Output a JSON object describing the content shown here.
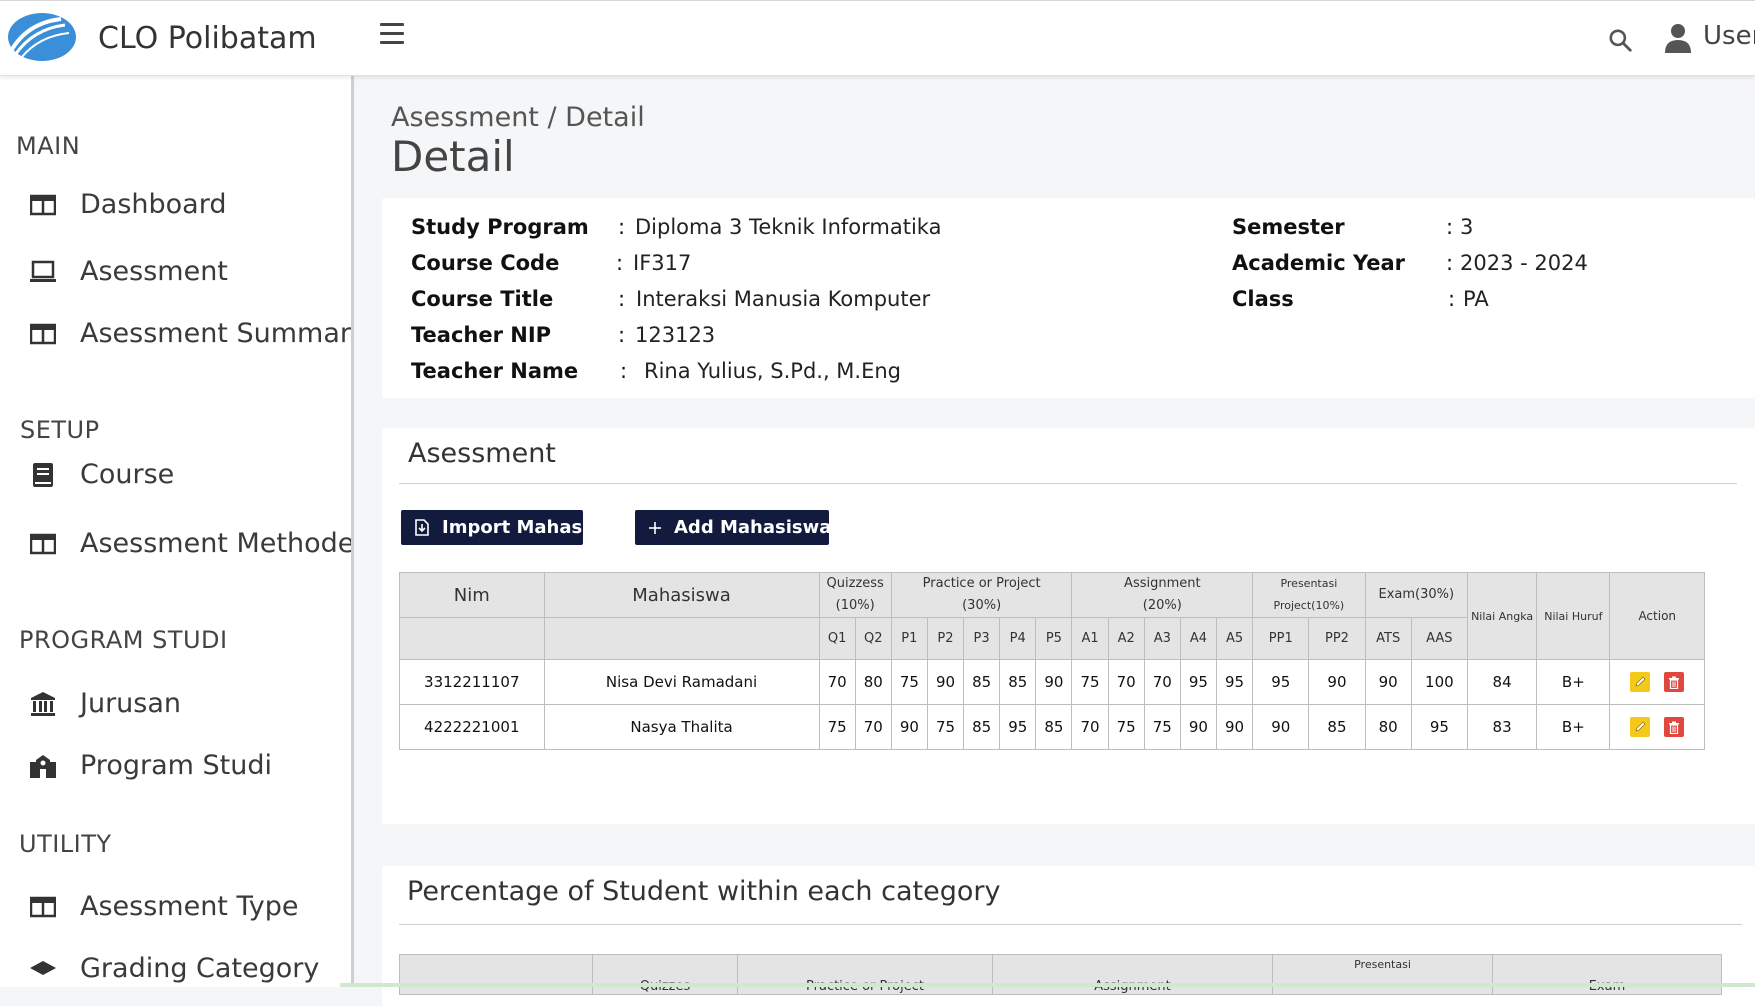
{
  "app": {
    "title": "CLO Polibatam",
    "user_label": "User"
  },
  "sidebar": {
    "sections": [
      {
        "title": "MAIN",
        "items": [
          {
            "label": "Dashboard",
            "icon": "table-icon"
          },
          {
            "label": "Asessment",
            "icon": "laptop-icon"
          },
          {
            "label": "Asessment Summary",
            "icon": "table-icon"
          }
        ]
      },
      {
        "title": "SETUP",
        "items": [
          {
            "label": "Course",
            "icon": "book-icon"
          },
          {
            "label": "Asessment Methode",
            "icon": "table-icon"
          }
        ]
      },
      {
        "title": "PROGRAM STUDI",
        "items": [
          {
            "label": "Jurusan",
            "icon": "bank-icon"
          },
          {
            "label": "Program Studi",
            "icon": "school-icon"
          }
        ]
      },
      {
        "title": "UTILITY",
        "items": [
          {
            "label": "Asessment Type",
            "icon": "table-icon"
          },
          {
            "label": "Grading Category",
            "icon": "graduation-cap-icon"
          }
        ]
      }
    ]
  },
  "breadcrumb": "Asessment / Detail",
  "page_title": "Detail",
  "info": {
    "separator": ":",
    "left": [
      {
        "label": "Study Program",
        "value": "Diploma 3 Teknik Informatika"
      },
      {
        "label": "Course Code",
        "value": "IF317"
      },
      {
        "label": "Course Title",
        "value": "Interaksi Manusia Komputer"
      },
      {
        "label": "Teacher NIP",
        "value": "123123"
      },
      {
        "label": "Teacher Name",
        "value": "Rina Yulius, S.Pd., M.Eng"
      }
    ],
    "right": [
      {
        "label": "Semester",
        "value": "3"
      },
      {
        "label": "Academic Year",
        "value": "2023 - 2024"
      },
      {
        "label": "Class",
        "value": "PA"
      }
    ]
  },
  "assessment": {
    "title": "Asessment",
    "buttons": {
      "import": "Import Mahasiswa",
      "add": "Add Mahasiswa"
    },
    "headers": {
      "nim": "Nim",
      "mahasiswa": "Mahasiswa",
      "groups": [
        {
          "l1": "Quizzess",
          "l2": "(10%)"
        },
        {
          "l1": "Practice or Project",
          "l2": "(30%)"
        },
        {
          "l1": "Assignment",
          "l2": "(20%)"
        },
        {
          "l1": "Presentasi",
          "l2": "Project(10%)"
        },
        {
          "l1": "Exam(30%)",
          "l2": ""
        }
      ],
      "nilai_angka": "Nilai Angka",
      "nilai_huruf": "Nilai Huruf",
      "action": "Action",
      "sub": [
        "Q1",
        "Q2",
        "P1",
        "P2",
        "P3",
        "P4",
        "P5",
        "A1",
        "A2",
        "A3",
        "A4",
        "A5",
        "PP1",
        "PP2",
        "ATS",
        "AAS"
      ]
    },
    "rows": [
      {
        "nim": "3312211107",
        "name": "Nisa Devi Ramadani",
        "scores": [
          "70",
          "80",
          "75",
          "90",
          "85",
          "85",
          "90",
          "75",
          "70",
          "70",
          "95",
          "95",
          "95",
          "90",
          "90",
          "100"
        ],
        "angka": "84",
        "huruf": "B+"
      },
      {
        "nim": "4222221001",
        "name": "Nasya Thalita",
        "scores": [
          "75",
          "70",
          "90",
          "75",
          "85",
          "95",
          "85",
          "70",
          "75",
          "75",
          "90",
          "90",
          "90",
          "85",
          "80",
          "95"
        ],
        "angka": "83",
        "huruf": "B+"
      }
    ]
  },
  "percentage": {
    "title": "Percentage of Student within each category",
    "headers": [
      "Quizzes",
      "Practice or Project",
      "Assignment",
      "Presentasi",
      "Exam"
    ]
  }
}
